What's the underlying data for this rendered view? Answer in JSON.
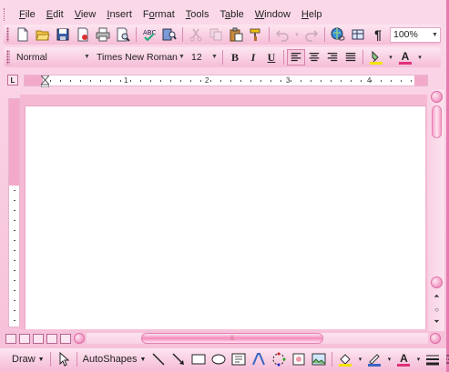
{
  "menu": {
    "items": [
      {
        "label": "File",
        "ul": "F",
        "rest": "ile"
      },
      {
        "label": "Edit",
        "ul": "E",
        "rest": "dit"
      },
      {
        "label": "View",
        "ul": "V",
        "rest": "iew"
      },
      {
        "label": "Insert",
        "ul": "I",
        "rest": "nsert"
      },
      {
        "label": "Format",
        "ul": "o",
        "pre": "F",
        "rest": "rmat"
      },
      {
        "label": "Tools",
        "ul": "T",
        "rest": "ools"
      },
      {
        "label": "Table",
        "ul": "a",
        "pre": "T",
        "rest": "ble"
      },
      {
        "label": "Window",
        "ul": "W",
        "rest": "indow"
      },
      {
        "label": "Help",
        "ul": "H",
        "rest": "elp"
      }
    ]
  },
  "standard_toolbar": {
    "zoom": "100%",
    "pilcrow": "¶"
  },
  "format_toolbar": {
    "style": "Normal",
    "font": "Times New Roman",
    "size": "12",
    "bold": "B",
    "italic": "I",
    "underline": "U",
    "font_color_letter": "A"
  },
  "ruler": {
    "numbers": [
      "1",
      "2",
      "3",
      "4"
    ],
    "corner": "L"
  },
  "draw_toolbar": {
    "draw_label": "Draw",
    "autoshapes_label": "AutoShapes"
  },
  "colors": {
    "accent": "#ee78b0",
    "background": "#f7c4dc",
    "highlight": "#f2e400",
    "font_color": "#e0307a"
  }
}
